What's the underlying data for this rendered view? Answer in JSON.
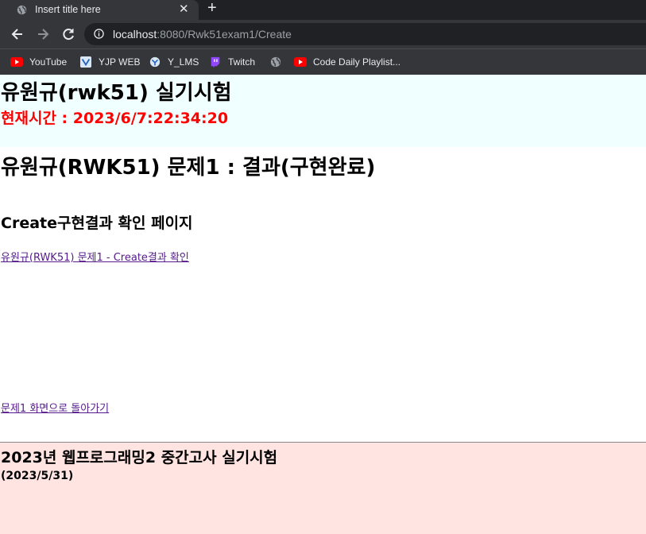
{
  "browser": {
    "tab_title": "Insert title here",
    "tab_close": "✕",
    "new_tab": "+",
    "url_host": "localhost",
    "url_path": ":8080/Rwk51exam1/Create",
    "bookmarks": [
      {
        "label": "YouTube",
        "icon": "youtube-icon"
      },
      {
        "label": "YJP WEB",
        "icon": "yjp-web-icon"
      },
      {
        "label": "Y_LMS",
        "icon": "y-lms-icon"
      },
      {
        "label": "Twitch",
        "icon": "twitch-icon"
      },
      {
        "label": "",
        "icon": "globe-icon"
      },
      {
        "label": "Code Daily Playlist...",
        "icon": "youtube-icon"
      }
    ]
  },
  "header": {
    "title": "유원규(rwk51) 실기시험",
    "current_time": "현재시간 : 2023/6/7:22:34:20",
    "background": "#f0ffff",
    "time_color": "#ff0000"
  },
  "main": {
    "problem_heading": "유원규(RWK51) 문제1 : 결과(구현완료)",
    "subheading": "Create구현결과 확인 페이지",
    "result_link": "유원규(RWK51) 문제1 - Create결과 확인",
    "back_link": "문제1 화면으로 돌아가기",
    "link_color": "#551a8b"
  },
  "footer": {
    "title": "2023년 웹프로그래밍2 중간고사 실기시험",
    "date": "(2023/5/31)",
    "background": "#ffe4e1"
  }
}
